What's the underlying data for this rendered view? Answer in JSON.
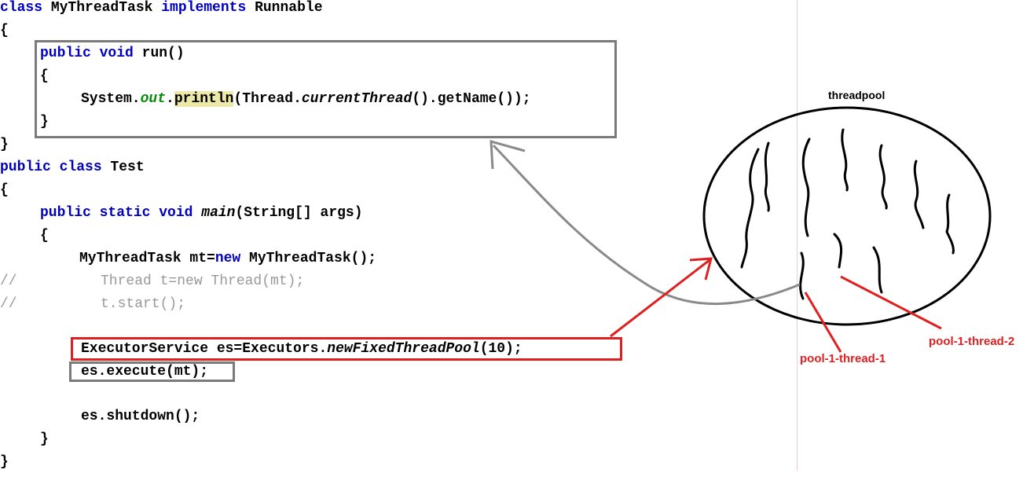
{
  "code": {
    "line1": {
      "kw1": "class",
      "name": " MyThreadTask ",
      "kw2": "implements",
      "rest": " Runnable"
    },
    "line2": "{",
    "line3": {
      "kw1": "public",
      "sp": " ",
      "kw2": "void",
      "rest": " run()"
    },
    "line4": "{",
    "line5": {
      "pre": "System.",
      "fld": "out",
      "dot": ".",
      "hl": "println",
      "a": "(Thread.",
      "it": "currentThread",
      "b": "().getName());"
    },
    "line6": "}",
    "line7": "}",
    "line8": {
      "kw1": "public",
      "sp": " ",
      "kw2": "class",
      "rest": " Test"
    },
    "line9": "{",
    "line10": {
      "kw1": "public",
      "kw2": "static",
      "kw3": "void",
      "it": "main",
      "rest": "(String[] args)"
    },
    "line11": "{",
    "line12": {
      "a": "MyThreadTask mt=",
      "kw": "new",
      "b": " MyThreadTask();"
    },
    "line13": {
      "slash": "//",
      "text": "Thread t=new Thread(mt);"
    },
    "line14": {
      "slash": "//",
      "text": "t.start();"
    },
    "line15": {
      "a": "ExecutorService es=Executors.",
      "it": "newFixedThreadPool",
      "b": "(10);"
    },
    "line16": "es.execute(mt);",
    "line17": "es.shutdown();",
    "line18": "}",
    "line19": "}"
  },
  "diagram": {
    "title": "threadpool",
    "thread1_label": "pool-1-thread-1",
    "thread2_label": "pool-1-thread-2"
  },
  "colors": {
    "keyword": "#0000c0",
    "field": "#0a8a0a",
    "highlight": "#ece9a6",
    "comment": "#999999",
    "red": "#e02020",
    "gray": "#7a7a7a"
  }
}
